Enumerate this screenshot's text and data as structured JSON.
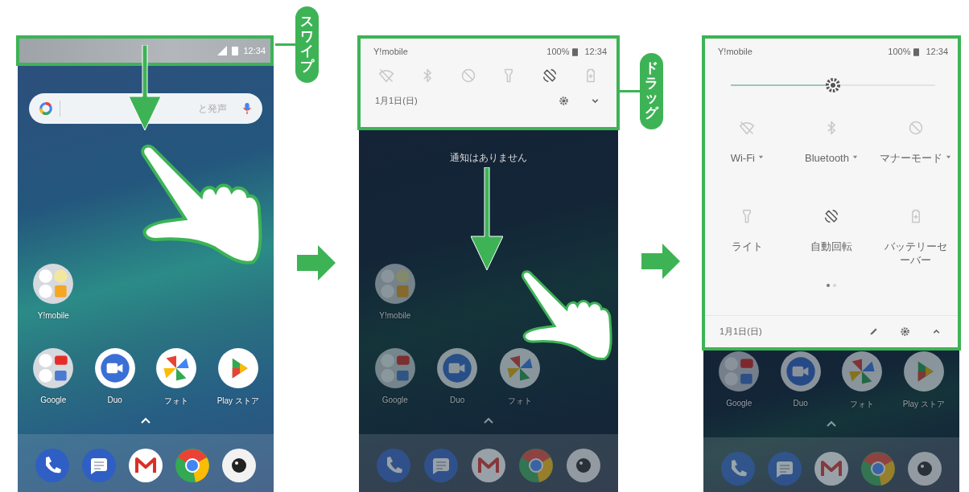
{
  "callouts": [
    {
      "label": "スワイプ"
    },
    {
      "label": "ドラッグ"
    }
  ],
  "screens": [
    {
      "kind": "home",
      "status_bar": {
        "time": "12:34"
      },
      "search": {
        "placeholder": "と発声"
      },
      "folder": {
        "label": "Y!mobile"
      },
      "apps": [
        {
          "label": "Google"
        },
        {
          "label": "Duo"
        },
        {
          "label": "フォト"
        },
        {
          "label": "Play ストア"
        }
      ]
    },
    {
      "kind": "shade",
      "header": {
        "carrier": "Y!mobile",
        "battery": "100%",
        "time": "12:34"
      },
      "tiles": [
        {
          "on": false
        },
        {
          "on": false
        },
        {
          "on": false
        },
        {
          "on": false
        },
        {
          "on": true
        },
        {
          "on": false
        }
      ],
      "date": "1月1日(日)",
      "notice": "通知はありません",
      "folder": {
        "label": "Y!mobile"
      },
      "apps": [
        {
          "label": "Google"
        },
        {
          "label": "Duo"
        },
        {
          "label": "フォト"
        }
      ]
    },
    {
      "kind": "quick_settings",
      "header": {
        "carrier": "Y!mobile",
        "battery": "100%",
        "time": "12:34"
      },
      "brightness": {
        "level": 0.5
      },
      "tiles": [
        {
          "label": "Wi-Fi",
          "on": false,
          "dropdown": true
        },
        {
          "label": "Bluetooth",
          "on": false,
          "dropdown": true
        },
        {
          "label": "マナーモード",
          "on": false,
          "dropdown": true
        },
        {
          "label": "ライト",
          "on": false,
          "dropdown": false
        },
        {
          "label": "自動回転",
          "on": true,
          "dropdown": false
        },
        {
          "label": "バッテリーセーバー",
          "on": false,
          "dropdown": false
        }
      ],
      "pages": [
        {
          "selected": true
        },
        {
          "selected": false
        }
      ],
      "date": "1月1日(日)",
      "apps": [
        {
          "label": "Google"
        },
        {
          "label": "Duo"
        },
        {
          "label": "フォト"
        },
        {
          "label": "Play ストア"
        }
      ]
    }
  ]
}
